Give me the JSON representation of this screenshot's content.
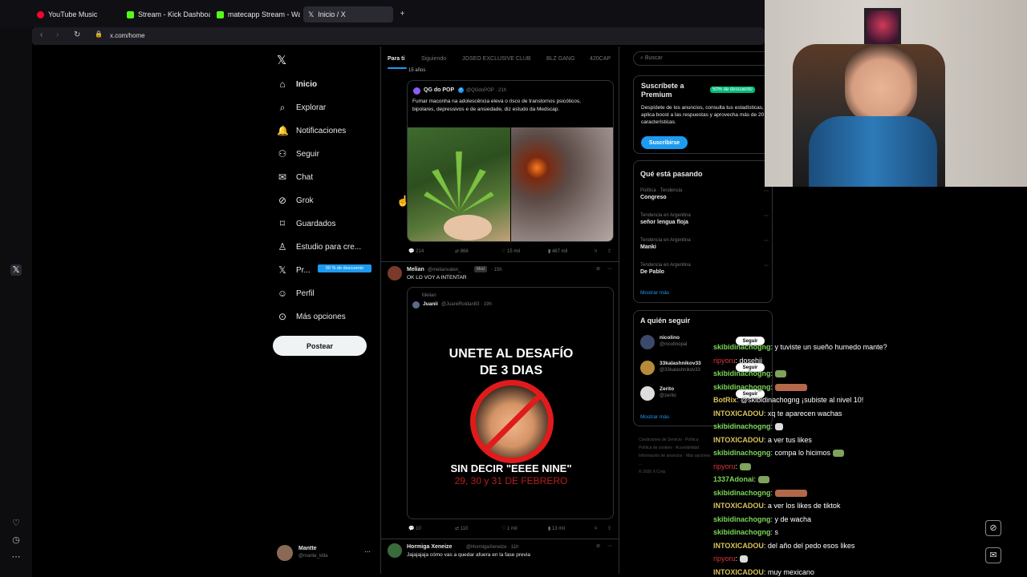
{
  "browser": {
    "tabs": [
      {
        "label": "YouTube Music",
        "color": "#ff0033"
      },
      {
        "label": "Stream - Kick Dashboard",
        "color": "#53fc18"
      },
      {
        "label": "matecapp Stream - Watch",
        "color": "#53fc18"
      },
      {
        "label": "Inicio / X",
        "color": "#ffffff"
      }
    ],
    "url": "x.com/home"
  },
  "nav": {
    "items": [
      {
        "label": "Inicio",
        "icon": "home-icon"
      },
      {
        "label": "Explorar",
        "icon": "search-icon"
      },
      {
        "label": "Notificaciones",
        "icon": "bell-icon"
      },
      {
        "label": "Seguir",
        "icon": "add-user-icon"
      },
      {
        "label": "Chat",
        "icon": "mail-icon"
      },
      {
        "label": "Grok",
        "icon": "grok-icon"
      },
      {
        "label": "Guardados",
        "icon": "bookmark-icon"
      },
      {
        "label": "Estudio para cre...",
        "icon": "studio-icon"
      },
      {
        "label": "Pr...",
        "icon": "x-icon"
      },
      {
        "label": "Perfil",
        "icon": "user-icon"
      },
      {
        "label": "Más opciones",
        "icon": "more-icon"
      }
    ],
    "premium_badge": "50 % de descuento",
    "post_label": "Postear",
    "account": {
      "name": "Mantte",
      "handle": "@mante_killa"
    }
  },
  "feed": {
    "tabs": [
      "Para ti",
      "Siguiendo",
      "JOSEO EXCLUSIVE CLUB",
      "BLZ GANG",
      "420CAP"
    ],
    "top_fragment": "15 años",
    "post1": {
      "author": "QG do POP",
      "handle": "@QGdoPOP · 21h",
      "text": "Fumar maconha na adolescência eleva o risco de transtornos psicóticos, bipolares, depressivos e de ansiedade, diz estudo da Medscap.",
      "replies": "214",
      "reposts": "866",
      "likes": "15 mil",
      "views": "487 mil"
    },
    "post2": {
      "author": "Melian",
      "handle": "@melianvalen_",
      "badge": "Mod",
      "time": "· 15h",
      "text": "OK LO VOY A INTENTAR",
      "quoted_by": "Melian",
      "quoted_author": "Juanii",
      "quoted_handle": "@JuaniiRoldan83 · 19h",
      "poster_line1": "UNETE AL DESAFÍO",
      "poster_line2": "DE 3 DIAS",
      "poster_line3": "SIN DECIR \"EEEE NINE\"",
      "poster_line4": "29, 30 y 31 DE FEBRERO",
      "replies": "10",
      "reposts": "110",
      "likes": "1 mil",
      "views": "13 mil"
    },
    "post3": {
      "author": "Hormiga Xeneize",
      "handle": "@HormigaXeneize · 11h",
      "text": "Jajajajaja cómo vas a quedar afuera en la fase previa"
    }
  },
  "right": {
    "search_placeholder": "Buscar",
    "premium": {
      "title_line1": "Suscríbete a",
      "title_line2": "Premium",
      "badge": "50% de descuento",
      "text": "Despídete de los anuncios, consulta tus estadísticas, aplica boost a las respuestas y aprovecha más de 20 características.",
      "button": "Suscribirse"
    },
    "trends": {
      "title": "Qué está pasando",
      "items": [
        {
          "context": "Política · Tendencia",
          "name": "Congreso"
        },
        {
          "context": "Tendencia en Argentina",
          "name": "señor lengua floja"
        },
        {
          "context": "Tendencia en Argentina",
          "name": "Manki"
        },
        {
          "context": "Tendencia en Argentina",
          "name": "De Pablo"
        }
      ],
      "show_more": "Mostrar más"
    },
    "who_to_follow": {
      "title": "A quién seguir",
      "items": [
        {
          "name": "nicolino",
          "handle": "@nicolinopal"
        },
        {
          "name": "33kalashnikov33",
          "handle": "@33kalashnikov33"
        },
        {
          "name": "Zerito",
          "handle": "@zerito"
        }
      ],
      "follow_label": "Seguir",
      "show_more": "Mostrar más"
    },
    "footer": [
      "Condiciones de Servicio",
      "Política",
      "Política de cookies",
      "Accesibilidad",
      "Información de anuncios",
      "Más opciones ...",
      "© 2026 X Corp."
    ]
  },
  "chat": [
    {
      "user": "skibidinachogng",
      "msg": ": y tuviste un sueño humedo mante?",
      "color": "green"
    },
    {
      "user": "ripyoru",
      "msg": ": dosehii",
      "color": "red"
    },
    {
      "user": "skibidinachogng",
      "msg": ":",
      "color": "green",
      "emote": "green"
    },
    {
      "user": "skibidinachogng",
      "msg": ":",
      "color": "green",
      "emote": "wide"
    },
    {
      "user": "BotRix",
      "msg": ": @skibidinachogng ¡subiste al nivel 10!",
      "color": "yellow"
    },
    {
      "user": "INTOXICADOU",
      "msg": ": xq te aparecen wachas",
      "color": "yellow"
    },
    {
      "user": "skibidinachogng",
      "msg": ":",
      "color": "green",
      "emote": "white"
    },
    {
      "user": "INTOXICADOU",
      "msg": ": a ver tus likes",
      "color": "yellow"
    },
    {
      "user": "skibidinachogng",
      "msg": ": compa lo hicimos",
      "color": "green",
      "emote": "green"
    },
    {
      "user": "ripyoru",
      "msg": ":",
      "color": "red",
      "emote": "green"
    },
    {
      "user": "1337Adonai",
      "msg": ":",
      "color": "green",
      "emote": "green"
    },
    {
      "user": "skibidinachogng",
      "msg": ":",
      "color": "green",
      "emote": "wide"
    },
    {
      "user": "INTOXICADOU",
      "msg": ": a ver los likes de tiktok",
      "color": "yellow"
    },
    {
      "user": "skibidinachogng",
      "msg": ": y de wacha",
      "color": "green"
    },
    {
      "user": "skibidinachogng",
      "msg": ": s",
      "color": "green"
    },
    {
      "user": "INTOXICADOU",
      "msg": ": del año del pedo esos likes",
      "color": "yellow"
    },
    {
      "user": "ripyoru",
      "msg": ":",
      "color": "red",
      "emote": "white"
    },
    {
      "user": "INTOXICADOU",
      "msg": ": muy mexicano",
      "color": "yellow"
    }
  ]
}
